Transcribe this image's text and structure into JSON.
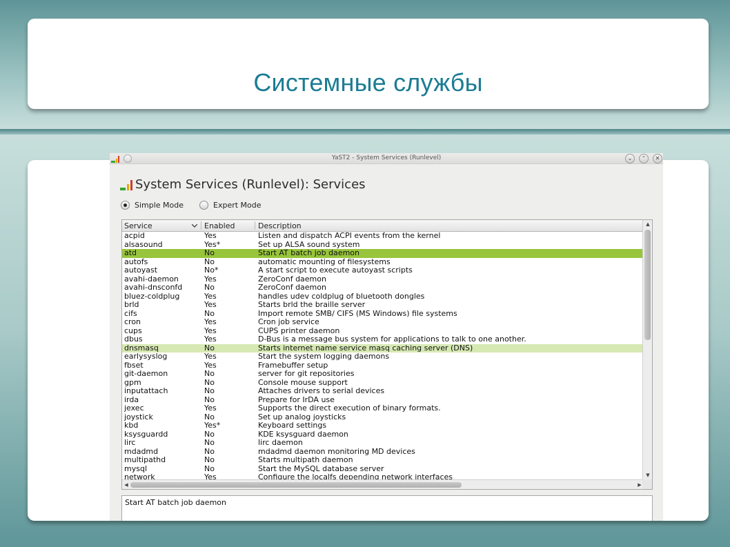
{
  "slide": {
    "title": "Системные службы"
  },
  "window": {
    "title": "YaST2 - System Services (Runlevel)",
    "heading": "System Services (Runlevel): Services",
    "simple_mode_label": "Simple Mode",
    "expert_mode_label": "Expert Mode",
    "selected_mode": "simple"
  },
  "table": {
    "columns": [
      "Service",
      "Enabled",
      "Description"
    ],
    "rows": [
      [
        "acpid",
        "Yes",
        "Listen and dispatch ACPI events from the kernel"
      ],
      [
        "alsasound",
        "Yes*",
        "Set up ALSA sound system"
      ],
      [
        "atd",
        "No",
        "Start AT batch job daemon"
      ],
      [
        "autofs",
        "No",
        "automatic mounting of filesystems"
      ],
      [
        "autoyast",
        "No*",
        "A start script to execute autoyast scripts"
      ],
      [
        "avahi-daemon",
        "Yes",
        "ZeroConf daemon"
      ],
      [
        "avahi-dnsconfd",
        "No",
        "ZeroConf daemon"
      ],
      [
        "bluez-coldplug",
        "Yes",
        "handles udev coldplug of bluetooth dongles"
      ],
      [
        "brld",
        "Yes",
        "Starts brld the braille server"
      ],
      [
        "cifs",
        "No",
        "Import remote SMB/ CIFS (MS Windows) file systems"
      ],
      [
        "cron",
        "Yes",
        "Cron job service"
      ],
      [
        "cups",
        "Yes",
        "CUPS printer daemon"
      ],
      [
        "dbus",
        "Yes",
        "D-Bus is a message bus system for applications to talk to one another."
      ],
      [
        "dnsmasq",
        "No",
        "Starts internet name service masq caching server (DNS)"
      ],
      [
        "earlysyslog",
        "Yes",
        "Start the system logging daemons"
      ],
      [
        "fbset",
        "Yes",
        "Framebuffer setup"
      ],
      [
        "git-daemon",
        "No",
        "server for git repositories"
      ],
      [
        "gpm",
        "No",
        "Console mouse support"
      ],
      [
        "inputattach",
        "No",
        "Attaches drivers to serial devices"
      ],
      [
        "irda",
        "No",
        "Prepare for IrDA use"
      ],
      [
        "jexec",
        "Yes",
        "Supports the direct execution of binary formats."
      ],
      [
        "joystick",
        "No",
        "Set up analog joysticks"
      ],
      [
        "kbd",
        "Yes*",
        "Keyboard settings"
      ],
      [
        "ksysguardd",
        "No",
        "KDE ksysguard daemon"
      ],
      [
        "lirc",
        "No",
        "lirc daemon"
      ],
      [
        "mdadmd",
        "No",
        "mdadmd daemon monitoring MD devices"
      ],
      [
        "multipathd",
        "No",
        "Starts multipath daemon"
      ],
      [
        "mysql",
        "No",
        "Start the MySQL database server"
      ],
      [
        "network",
        "Yes",
        "Configure the localfs depending network interfaces"
      ]
    ],
    "selected_row": 2,
    "highlighted_row": 13,
    "colors": {
      "selected": "#98c53c",
      "highlighted": "#d6e9b3"
    }
  },
  "description_box": {
    "text": "Start AT batch job daemon"
  }
}
